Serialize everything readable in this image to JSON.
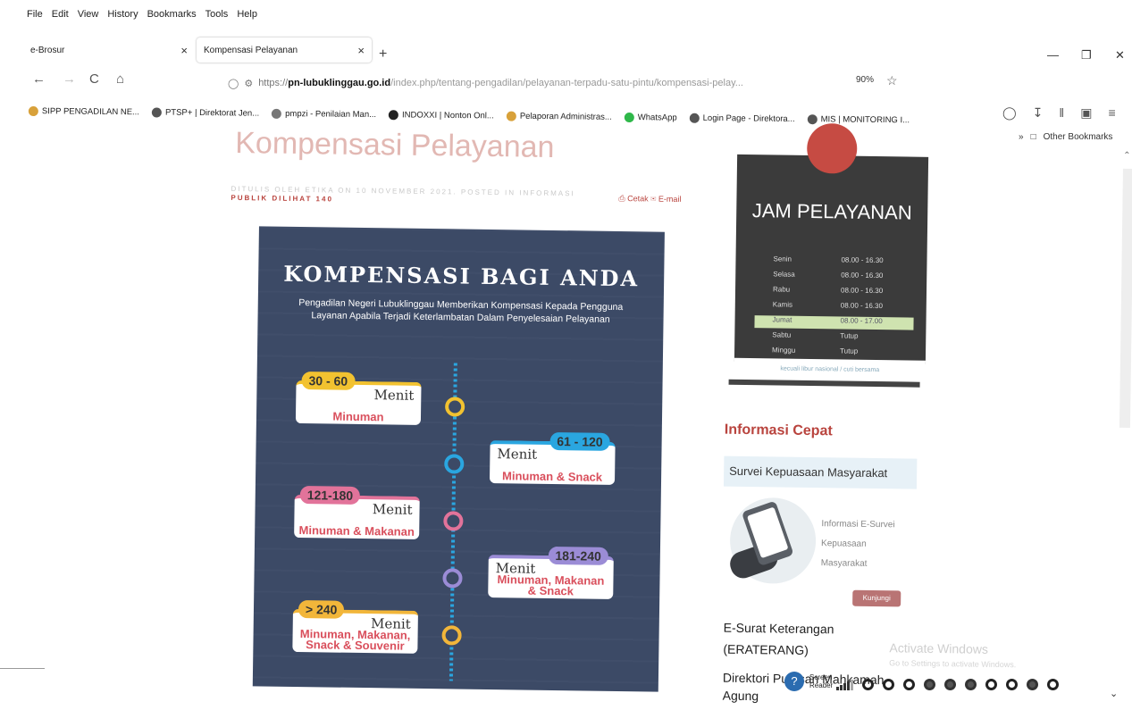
{
  "menu": [
    "File",
    "Edit",
    "View",
    "History",
    "Bookmarks",
    "Tools",
    "Help"
  ],
  "tabs": [
    {
      "label": "e-Brosur",
      "close": "×"
    },
    {
      "label": "Kompensasi Pelayanan",
      "close": "×"
    }
  ],
  "new_tab": "+",
  "window": {
    "minimize": "—",
    "restore": "❐",
    "close": "✕"
  },
  "nav": {
    "back": "←",
    "forward": "→",
    "reload": "C",
    "home": "⌂",
    "shield": "◯",
    "lock": "🔒"
  },
  "url": {
    "prefix": "https://",
    "host": "pn-lubuklinggau.go.id",
    "path": "/index.php/tentang-pengadilan/pelayanan-terpadu-satu-pintu/kompensasi-pelay..."
  },
  "zoom": "90%",
  "bookmarks": [
    {
      "label": "SIPP PENGADILAN NE...",
      "color": "#d8a13a"
    },
    {
      "label": "PTSP+ | Direktorat Jen...",
      "color": "#555"
    },
    {
      "label": "pmpzi - Penilaian Man...",
      "color": "#777"
    },
    {
      "label": "INDOXXI | Nonton Onl...",
      "color": "#222"
    },
    {
      "label": "Pelaporan Administras...",
      "color": "#d8a13a"
    },
    {
      "label": "WhatsApp",
      "color": "#2fb84a"
    },
    {
      "label": "Login Page - Direktora...",
      "color": "#555"
    },
    {
      "label": "MIS | MONITORING I...",
      "color": "#555"
    }
  ],
  "other_bookmarks": "Other Bookmarks",
  "article": {
    "title": "Kompensasi Pelayanan",
    "meta_line1": "DITULIS OLEH ETIKA ON 10 NOVEMBER 2021. POSTED IN INFORMASI",
    "meta_line2": "PUBLIK DILIHAT 140",
    "print": "Cetak",
    "email": "E-mail"
  },
  "poster": {
    "title": "KOMPENSASI BAGI ANDA",
    "subtitle": "Pengadilan Negeri Lubuklinggau Memberikan Kompensasi Kepada Pengguna Layanan Apabila Terjadi Keterlambatan Dalam Penyelesaian Pelayanan",
    "items": [
      {
        "range": "30 - 60",
        "unit": "Menit",
        "reward": "Minuman",
        "color": "#f2c230"
      },
      {
        "range": "61 - 120",
        "unit": "Menit",
        "reward": "Minuman & Snack",
        "color": "#2aa6e0"
      },
      {
        "range": "121-180",
        "unit": "Menit",
        "reward": "Minuman & Makanan",
        "color": "#e2739a"
      },
      {
        "range": "181-240",
        "unit": "Menit",
        "reward": "Minuman, Makanan & Snack",
        "color": "#9b8cd6"
      },
      {
        "range": "> 240",
        "unit": "Menit",
        "reward": "Minuman, Makanan, Snack & Souvenir",
        "color": "#f2b63a"
      }
    ]
  },
  "jam": {
    "title": "JAM PELAYANAN",
    "rows": [
      {
        "day": "Senin",
        "time": "08.00 - 16.30"
      },
      {
        "day": "Selasa",
        "time": "08.00 - 16.30"
      },
      {
        "day": "Rabu",
        "time": "08.00 - 16.30"
      },
      {
        "day": "Kamis",
        "time": "08.00 - 16.30"
      },
      {
        "day": "Jumat",
        "time": "08.00 - 17.00"
      },
      {
        "day": "Sabtu",
        "time": "Tutup"
      },
      {
        "day": "Minggu",
        "time": "Tutup"
      }
    ],
    "footer": "kecuali libur nasional / cuti bersama"
  },
  "sidebar": {
    "info_title": "Informasi Cepat",
    "survey_title": "Survei Kepuasaan Masyarakat",
    "survey_text": [
      "Informasi E-Survei",
      "Kepuasaan",
      "Masyarakat"
    ],
    "visit": "Kunjungi",
    "esurat": [
      "E-Surat Keterangan",
      "(ERATERANG)"
    ],
    "direktori": [
      "Direktori Putusan Mahkamah",
      "Agung"
    ]
  },
  "activate": {
    "title": "Activate Windows",
    "sub": "Go to Settings to activate Windows."
  },
  "screen_reader": {
    "label1": "Screen",
    "label2": "Reader"
  }
}
